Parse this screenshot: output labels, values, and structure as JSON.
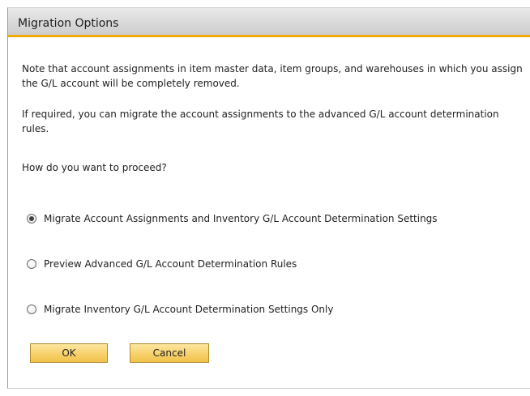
{
  "dialog": {
    "title": "Migration Options",
    "accent_color": "#f0ab00"
  },
  "body": {
    "note": "Note that account assignments in item master data, item groups, and warehouses in which you assign the G/L account will be completely removed.",
    "info": "If required, you can migrate the account assignments to the advanced G/L account determination rules.",
    "question": "How do you want to proceed?"
  },
  "options": [
    {
      "label": "Migrate Account Assignments and Inventory G/L Account Determination Settings",
      "selected": true
    },
    {
      "label": "Preview Advanced G/L Account Determination Rules",
      "selected": false
    },
    {
      "label": "Migrate Inventory G/L Account Determination Settings Only",
      "selected": false
    }
  ],
  "buttons": {
    "ok_label": "OK",
    "cancel_label": "Cancel",
    "color": "#f7cf68"
  }
}
